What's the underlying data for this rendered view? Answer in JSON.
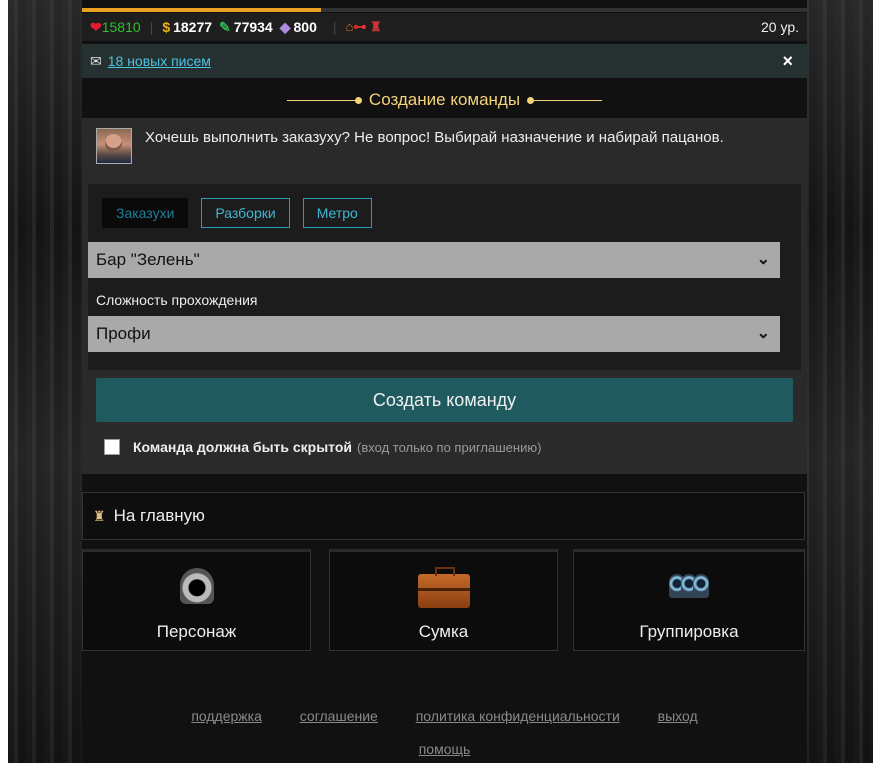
{
  "stats": {
    "health": "15810",
    "money": "18277",
    "gems": "77934",
    "crystals": "800",
    "level": "20 ур."
  },
  "mail": {
    "link": "18 новых писем",
    "close": "×"
  },
  "page_title": "Создание команды",
  "npc": {
    "text": "Хочешь выполнить заказуху? Не вопрос! Выбирай назначение и набирай пацанов."
  },
  "tabs": [
    {
      "label": "Заказухи",
      "active": true
    },
    {
      "label": "Разборки",
      "active": false
    },
    {
      "label": "Метро",
      "active": false
    }
  ],
  "target_select": {
    "value": "Бар \"Зелень\""
  },
  "difficulty": {
    "label": "Сложность прохождения",
    "value": "Профи"
  },
  "create_button": "Создать команду",
  "hidden_option": {
    "label": "Команда должна быть скрытой",
    "note": "(вход только по приглашению)",
    "checked": false
  },
  "home": "На главную",
  "nav": {
    "character": "Персонаж",
    "bag": "Сумка",
    "group": "Группировка"
  },
  "footer": {
    "support": "поддержка",
    "agreement": "соглашение",
    "privacy": "политика конфиденциальности",
    "logout": "выход",
    "help": "помощь"
  },
  "colors": {
    "accent": "#1f5b5e",
    "title": "#f3d27a",
    "link": "#4ec3e0",
    "progress": "#e8a21f"
  },
  "progress_fraction": 0.33
}
